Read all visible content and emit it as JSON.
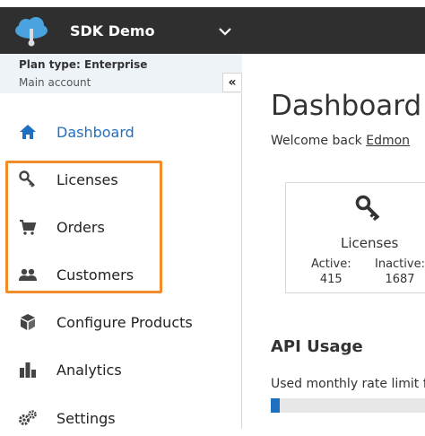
{
  "header": {
    "app_name": "SDK Demo",
    "logo_icon": "cloud-key-icon",
    "menu_icon": "chevron-down-icon",
    "bg_color": "#2f2f2f"
  },
  "sidebar": {
    "plan_type": "Plan type: Enterprise",
    "account": "Main account",
    "collapse_label": "«",
    "items": [
      {
        "label": "Dashboard",
        "icon": "home-icon",
        "active": true
      },
      {
        "label": "Licenses",
        "icon": "key-icon",
        "active": false
      },
      {
        "label": "Orders",
        "icon": "cart-icon",
        "active": false
      },
      {
        "label": "Customers",
        "icon": "users-icon",
        "active": false
      },
      {
        "label": "Configure Products",
        "icon": "cube-icon",
        "active": false
      },
      {
        "label": "Analytics",
        "icon": "bar-chart-icon",
        "active": false
      },
      {
        "label": "Settings",
        "icon": "gears-icon",
        "active": false
      }
    ],
    "active_color": "#1f70c1",
    "highlight_color": "#f28c28"
  },
  "main": {
    "title": "Dashboard",
    "welcome_prefix": "Welcome back ",
    "user_name": "Edmon",
    "card": {
      "icon": "key-icon",
      "title": "Licenses",
      "active_label": "Active:",
      "active_value": "415",
      "inactive_label": "Inactive:",
      "inactive_value": "1687"
    },
    "api": {
      "title": "API Usage",
      "usage_label": "Used monthly rate limit fo",
      "progress_fraction": 0.06
    }
  }
}
